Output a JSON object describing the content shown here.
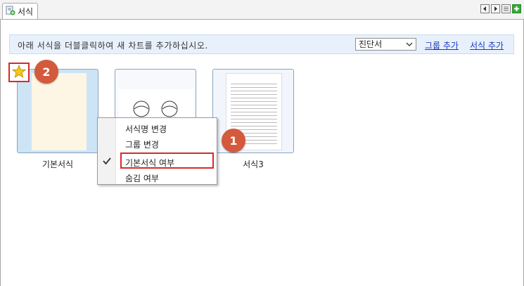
{
  "tab": {
    "label": "서식",
    "icon": "template-icon"
  },
  "nav": {
    "icons": [
      "prev-icon",
      "next-icon",
      "list-icon",
      "add-icon"
    ]
  },
  "infobar": {
    "text": "아래 서식을 더블클릭하여 새 차트를 추가하십시오.",
    "select_value": "진단서",
    "link_add_group": "그룹 추가",
    "link_add_template": "서식 추가"
  },
  "templates": [
    {
      "label": "기본서식"
    },
    {
      "label": ""
    },
    {
      "label": "서식3"
    }
  ],
  "context_menu": {
    "items": [
      {
        "label": "서식명 변경",
        "checked": false
      },
      {
        "label": "그룹 변경",
        "checked": false
      },
      {
        "label": "기본서식 여부",
        "checked": true
      },
      {
        "label": "숨김 여부",
        "checked": false
      }
    ]
  },
  "badges": {
    "one": "1",
    "two": "2"
  },
  "colors": {
    "accent": "#d62a2a",
    "badge": "#d35a3c",
    "link": "#1a38c2",
    "infobar": "#e8f1fb"
  }
}
